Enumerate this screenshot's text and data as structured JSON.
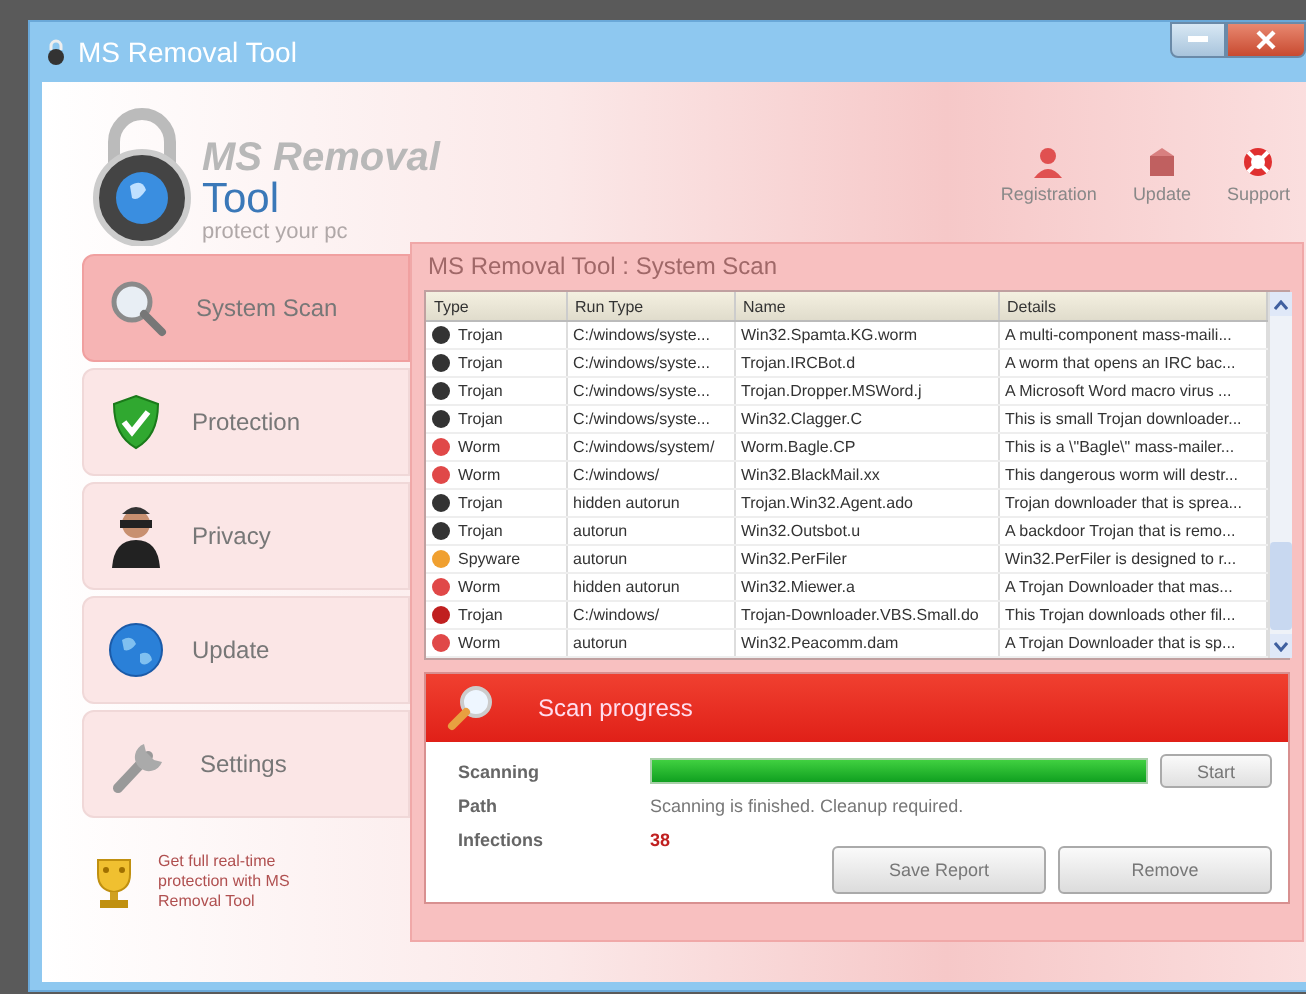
{
  "window": {
    "title": "MS Removal Tool"
  },
  "logo": {
    "name_line1": "MS Removal",
    "name_line2": "Tool",
    "tagline": "protect your pc"
  },
  "header_links": [
    {
      "label": "Registration",
      "kind": "person"
    },
    {
      "label": "Update",
      "kind": "box"
    },
    {
      "label": "Support",
      "kind": "lifebuoy"
    }
  ],
  "sidebar": {
    "items": [
      {
        "label": "System Scan",
        "kind": "scan",
        "selected": true
      },
      {
        "label": "Protection",
        "kind": "shield",
        "selected": false
      },
      {
        "label": "Privacy",
        "kind": "spy",
        "selected": false
      },
      {
        "label": "Update",
        "kind": "globe",
        "selected": false
      },
      {
        "label": "Settings",
        "kind": "wrench",
        "selected": false
      }
    ],
    "promo": "Get full real-time protection with MS Removal Tool"
  },
  "panel": {
    "title": "MS Removal Tool : System Scan"
  },
  "table": {
    "columns": [
      "Type",
      "Run Type",
      "Name",
      "Details"
    ],
    "rows": [
      {
        "type": "Trojan",
        "color": "#333333",
        "run_type": "C:/windows/syste...",
        "name": "Win32.Spamta.KG.worm",
        "details": "A multi-component mass-maili..."
      },
      {
        "type": "Trojan",
        "color": "#333333",
        "run_type": "C:/windows/syste...",
        "name": "Trojan.IRCBot.d",
        "details": "A worm that opens an IRC bac..."
      },
      {
        "type": "Trojan",
        "color": "#333333",
        "run_type": "C:/windows/syste...",
        "name": "Trojan.Dropper.MSWord.j",
        "details": "A Microsoft Word macro virus ..."
      },
      {
        "type": "Trojan",
        "color": "#333333",
        "run_type": "C:/windows/syste...",
        "name": "Win32.Clagger.C",
        "details": "This is small Trojan downloader..."
      },
      {
        "type": "Worm",
        "color": "#e04848",
        "run_type": "C:/windows/system/",
        "name": "Worm.Bagle.CP",
        "details": "This is a \\\"Bagle\\\" mass-mailer..."
      },
      {
        "type": "Worm",
        "color": "#e04848",
        "run_type": "C:/windows/",
        "name": "Win32.BlackMail.xx",
        "details": "This dangerous worm will destr..."
      },
      {
        "type": "Trojan",
        "color": "#333333",
        "run_type": "hidden autorun",
        "name": "Trojan.Win32.Agent.ado",
        "details": "Trojan downloader that is sprea..."
      },
      {
        "type": "Trojan",
        "color": "#333333",
        "run_type": "autorun",
        "name": "Win32.Outsbot.u",
        "details": "A backdoor Trojan that is remo..."
      },
      {
        "type": "Spyware",
        "color": "#f0a030",
        "run_type": "autorun",
        "name": "Win32.PerFiler",
        "details": "Win32.PerFiler is designed to r..."
      },
      {
        "type": "Worm",
        "color": "#e04848",
        "run_type": "hidden autorun",
        "name": "Win32.Miewer.a",
        "details": "A Trojan Downloader that mas..."
      },
      {
        "type": "Trojan",
        "color": "#c02020",
        "run_type": "C:/windows/",
        "name": "Trojan-Downloader.VBS.Small.do",
        "details": "This Trojan downloads other fil..."
      },
      {
        "type": "Worm",
        "color": "#e04848",
        "run_type": "autorun",
        "name": "Win32.Peacomm.dam",
        "details": "A Trojan Downloader that is sp..."
      }
    ]
  },
  "scan": {
    "title": "Scan progress",
    "scanning_label": "Scanning",
    "level": 1.0,
    "start_button": "Start",
    "path_label": "Path",
    "path_value": "Scanning is finished. Cleanup required.",
    "infections_label": "Infections",
    "infections_value": "38",
    "buttons": [
      "Save Report",
      "Remove"
    ]
  }
}
